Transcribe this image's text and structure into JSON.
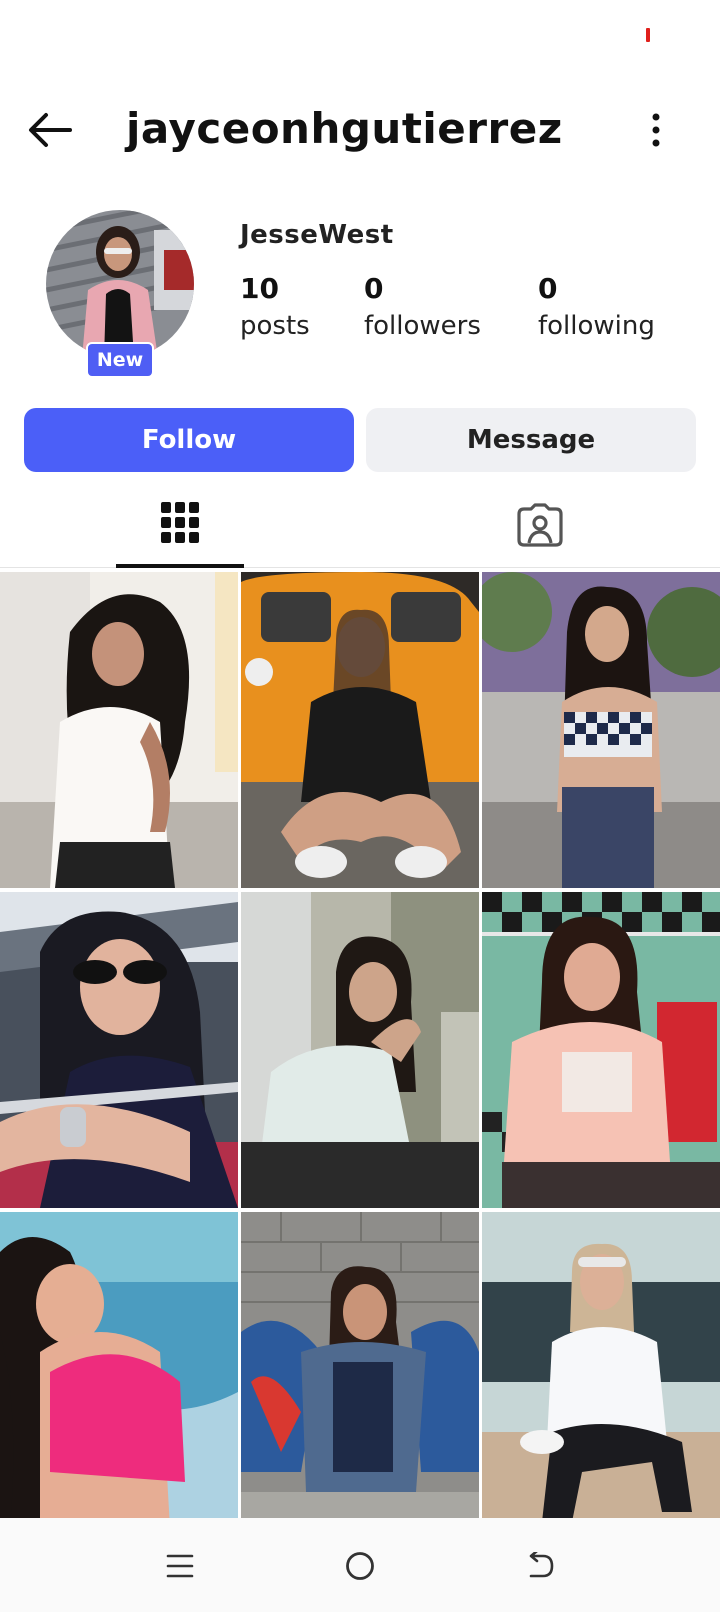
{
  "header": {
    "username": "jayceonhgutierrez",
    "back_icon": "arrow-left-icon",
    "more_icon": "more-vertical-icon"
  },
  "profile": {
    "display_name": "JesseWest",
    "badge": "New",
    "stats": [
      {
        "value": "10",
        "label": "posts"
      },
      {
        "value": "0",
        "label": "followers"
      },
      {
        "value": "0",
        "label": "following"
      }
    ]
  },
  "actions": {
    "follow_label": "Follow",
    "message_label": "Message"
  },
  "tabs": [
    {
      "icon": "grid-icon",
      "active": true
    },
    {
      "icon": "tagged-person-icon",
      "active": false
    }
  ],
  "nav": {
    "icons": [
      "recents-icon",
      "home-icon",
      "back-icon"
    ]
  },
  "colors": {
    "accent": "#4b5ff8",
    "secondary_button": "#eff0f3",
    "status_indicator": "#e0201c"
  }
}
